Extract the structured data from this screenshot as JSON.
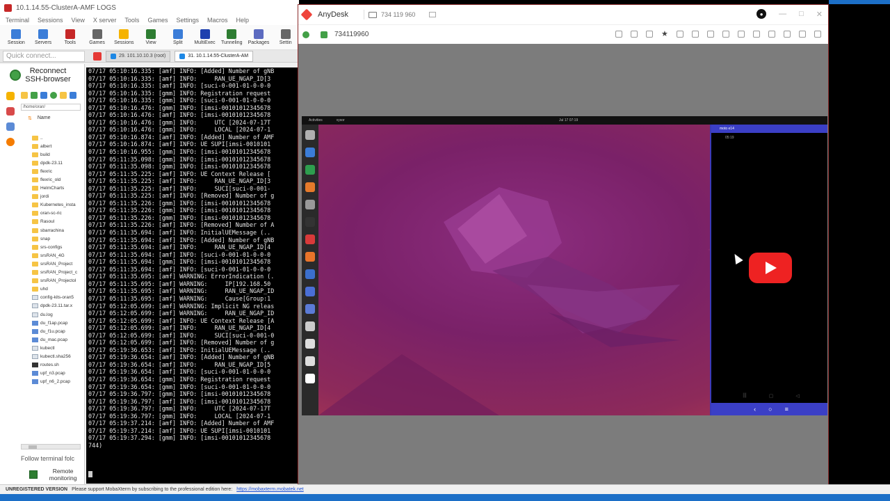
{
  "moba": {
    "title": "10.1.14.55-ClusterA-AMF LOGS",
    "menu": [
      "Terminal",
      "Sessions",
      "View",
      "X server",
      "Tools",
      "Games",
      "Settings",
      "Macros",
      "Help"
    ],
    "toolbar": [
      {
        "label": "Session",
        "icon": "monitor-icon",
        "color": "#3b7dd8"
      },
      {
        "label": "Servers",
        "icon": "servers-icon",
        "color": "#3b7dd8"
      },
      {
        "label": "Tools",
        "icon": "tools-icon",
        "color": "#c62828"
      },
      {
        "label": "Games",
        "icon": "games-icon",
        "color": "#666666"
      },
      {
        "label": "Sessions",
        "icon": "star-icon",
        "color": "#f5b300"
      },
      {
        "label": "View",
        "icon": "view-icon",
        "color": "#2e7d32"
      },
      {
        "label": "Split",
        "icon": "split-icon",
        "color": "#3b7dd8"
      },
      {
        "label": "MultiExec",
        "icon": "multiexec-icon",
        "color": "#1e40af"
      },
      {
        "label": "Tunneling",
        "icon": "tunneling-icon",
        "color": "#2e7d32"
      },
      {
        "label": "Packages",
        "icon": "packages-icon",
        "color": "#5c6bc0"
      },
      {
        "label": "Settin",
        "icon": "settings-icon",
        "color": "#666666"
      }
    ],
    "quick_connect_placeholder": "Quick connect...",
    "tabs": [
      {
        "label": "29. 101.10.10.3 (root)"
      },
      {
        "label": "31. 10.1.14.55-ClusterA-AM"
      }
    ],
    "reconnect_label": "Reconnect SSH-browser",
    "side_path": "/home/oran/",
    "file_header": "Name",
    "files": [
      {
        "name": "..",
        "kind": "folder"
      },
      {
        "name": "albert",
        "kind": "folder"
      },
      {
        "name": "build",
        "kind": "folder"
      },
      {
        "name": "dpdk-23.11",
        "kind": "folder"
      },
      {
        "name": "flexric",
        "kind": "folder"
      },
      {
        "name": "flexric_old",
        "kind": "folder"
      },
      {
        "name": "HelmCharts",
        "kind": "folder"
      },
      {
        "name": "jordi",
        "kind": "folder"
      },
      {
        "name": "Kubernetes_insta",
        "kind": "folder"
      },
      {
        "name": "oran-sc-ric",
        "kind": "folder"
      },
      {
        "name": "Rasoul",
        "kind": "folder"
      },
      {
        "name": "sbarrachina",
        "kind": "folder"
      },
      {
        "name": "snap",
        "kind": "folder"
      },
      {
        "name": "srs-configs",
        "kind": "folder"
      },
      {
        "name": "srsRAN_4G",
        "kind": "folder"
      },
      {
        "name": "srsRAN_Project",
        "kind": "folder"
      },
      {
        "name": "srsRAN_Project_c",
        "kind": "folder"
      },
      {
        "name": "srsRAN_Projectol",
        "kind": "folder"
      },
      {
        "name": "uhd",
        "kind": "folder"
      },
      {
        "name": "config-kits-oran5",
        "kind": "file"
      },
      {
        "name": "dpdk-23.11.tar.x",
        "kind": "file"
      },
      {
        "name": "du.log",
        "kind": "file"
      },
      {
        "name": "du_f1ap.pcap",
        "kind": "pcap"
      },
      {
        "name": "du_f1u.pcap",
        "kind": "pcap"
      },
      {
        "name": "du_mac.pcap",
        "kind": "pcap"
      },
      {
        "name": "kubectl",
        "kind": "file"
      },
      {
        "name": "kubectl.sha256",
        "kind": "file"
      },
      {
        "name": "routes.sh",
        "kind": "sh"
      },
      {
        "name": "upf_n3.pcap",
        "kind": "pcap"
      },
      {
        "name": "upf_n6_2.pcap",
        "kind": "pcap"
      }
    ],
    "follow_label": "Follow terminal folc",
    "remote_label": "Remote monitoring",
    "terminal_lines": [
      "07/17 05:10:16.335: [amf] INFO: [Added] Number of gNB",
      "07/17 05:10:16.335: [amf] INFO:     RAN_UE_NGAP_ID[3",
      "07/17 05:10:16.335: [amf] INFO: [suci-0-001-01-0-0-0",
      "07/17 05:10:16.335: [gmm] INFO: Registration request",
      "07/17 05:10:16.335: [gmm] INFO: [suci-0-001-01-0-0-0",
      "07/17 05:10:16.476: [gmm] INFO: [imsi-00101012345678",
      "07/17 05:10:16.476: [amf] INFO: [imsi-00101012345678",
      "07/17 05:10:16.476: [gmm] INFO:     UTC [2024-07-17T",
      "07/17 05:10:16.476: [gmm] INFO:     LOCAL [2024-07-1",
      "07/17 05:10:16.874: [amf] INFO: [Added] Number of AMF",
      "07/17 05:10:16.874: [amf] INFO: UE SUPI[imsi-0010101",
      "07/17 05:10:16.955: [gmm] INFO: [imsi-00101012345678",
      "07/17 05:11:35.098: [gmm] INFO: [imsi-00101012345678",
      "07/17 05:11:35.098: [gmm] INFO: [imsi-00101012345678",
      "07/17 05:11:35.225: [amf] INFO: UE Context Release [",
      "07/17 05:11:35.225: [amf] INFO:     RAN_UE_NGAP_ID[3",
      "07/17 05:11:35.225: [amf] INFO:     SUCI[suci-0-001-",
      "07/17 05:11:35.225: [amf] INFO: [Removed] Number of g",
      "07/17 05:11:35.226: [gmm] INFO: [imsi-00101012345678",
      "07/17 05:11:35.226: [gmm] INFO: [imsi-00101012345678",
      "07/17 05:11:35.226: [gmm] INFO: [imsi-00101012345678",
      "07/17 05:11:35.226: [amf] INFO: [Removed] Number of A",
      "07/17 05:11:35.694: [amf] INFO: InitialUEMessage (..",
      "07/17 05:11:35.694: [amf] INFO: [Added] Number of gNB",
      "07/17 05:11:35.694: [amf] INFO:     RAN_UE_NGAP_ID[4",
      "07/17 05:11:35.694: [amf] INFO: [suci-0-001-01-0-0-0",
      "07/17 05:11:35.694: [gmm] INFO: [imsi-00101012345678",
      "07/17 05:11:35.694: [amf] INFO: [suci-0-001-01-0-0-0",
      "07/17 05:11:35.695: [amf] WARNING: ErrorIndication (.",
      "07/17 05:11:35.695: [amf] WARNING:     IP[192.168.50",
      "07/17 05:11:35.695: [amf] WARNING:     RAN_UE_NGAP_ID",
      "07/17 05:11:35.695: [amf] WARNING:     Cause[Group:1",
      "07/17 05:12:05.699: [amf] WARNING: Implicit NG releas",
      "07/17 05:12:05.699: [amf] WARNING:     RAN_UE_NGAP_ID",
      "07/17 05:12:05.699: [amf] INFO: UE Context Release [A",
      "07/17 05:12:05.699: [amf] INFO:     RAN_UE_NGAP_ID[4",
      "07/17 05:12:05.699: [amf] INFO:     SUCI[suci-0-001-0",
      "07/17 05:12:05.699: [amf] INFO: [Removed] Number of g",
      "07/17 05:19:36.653: [amf] INFO: InitialUEMessage (..",
      "07/17 05:19:36.654: [amf] INFO: [Added] Number of gNB",
      "07/17 05:19:36.654: [amf] INFO:     RAN_UE_NGAP_ID[5",
      "07/17 05:19:36.654: [amf] INFO: [suci-0-001-01-0-0-0",
      "07/17 05:19:36.654: [gmm] INFO: Registration request",
      "07/17 05:19:36.654: [gmm] INFO: [suci-0-001-01-0-0-0",
      "07/17 05:19:36.797: [gmm] INFO: [imsi-00101012345678",
      "07/17 05:19:36.797: [amf] INFO: [imsi-00101012345678",
      "07/17 05:19:36.797: [gmm] INFO:     UTC [2024-07-17T",
      "07/17 05:19:36.797: [gmm] INFO:     LOCAL [2024-07-1",
      "07/17 05:19:37.214: [amf] INFO: [Added] Number of AMF",
      "07/17 05:19:37.214: [amf] INFO: UE SUPI[imsi-0010101",
      "07/17 05:19:37.294: [gmm] INFO: [imsi-00101012345678",
      "744)"
    ],
    "status_unregistered": "UNREGISTERED VERSION",
    "status_text": "Please support MobaXterm by subscribing to the professional edition here:",
    "status_link": "https://mobaxterm.mobatek.net"
  },
  "anydesk": {
    "app_name": "AnyDesk",
    "tab_id": "734 119 960",
    "address_id": "734119960",
    "remote": {
      "topbar_left": "Activities",
      "topbar_app": "vysor",
      "clock": "Jul 17 07:19",
      "phone_title": "moto e14",
      "phone_time": "05:19",
      "dock_colors": [
        "#b0b0b0",
        "#3b7dd8",
        "#2e9e4e",
        "#e57a2b",
        "#999999",
        "#333333",
        "#d83a3a",
        "#e8742a",
        "#3b6fcc",
        "#4a6fd6",
        "#5b7bd6",
        "#cccccc",
        "#dddddd",
        "#dddddd",
        "#ffffff"
      ],
      "nav_back": "‹",
      "nav_home": "○",
      "nav_menu": "≡"
    }
  }
}
